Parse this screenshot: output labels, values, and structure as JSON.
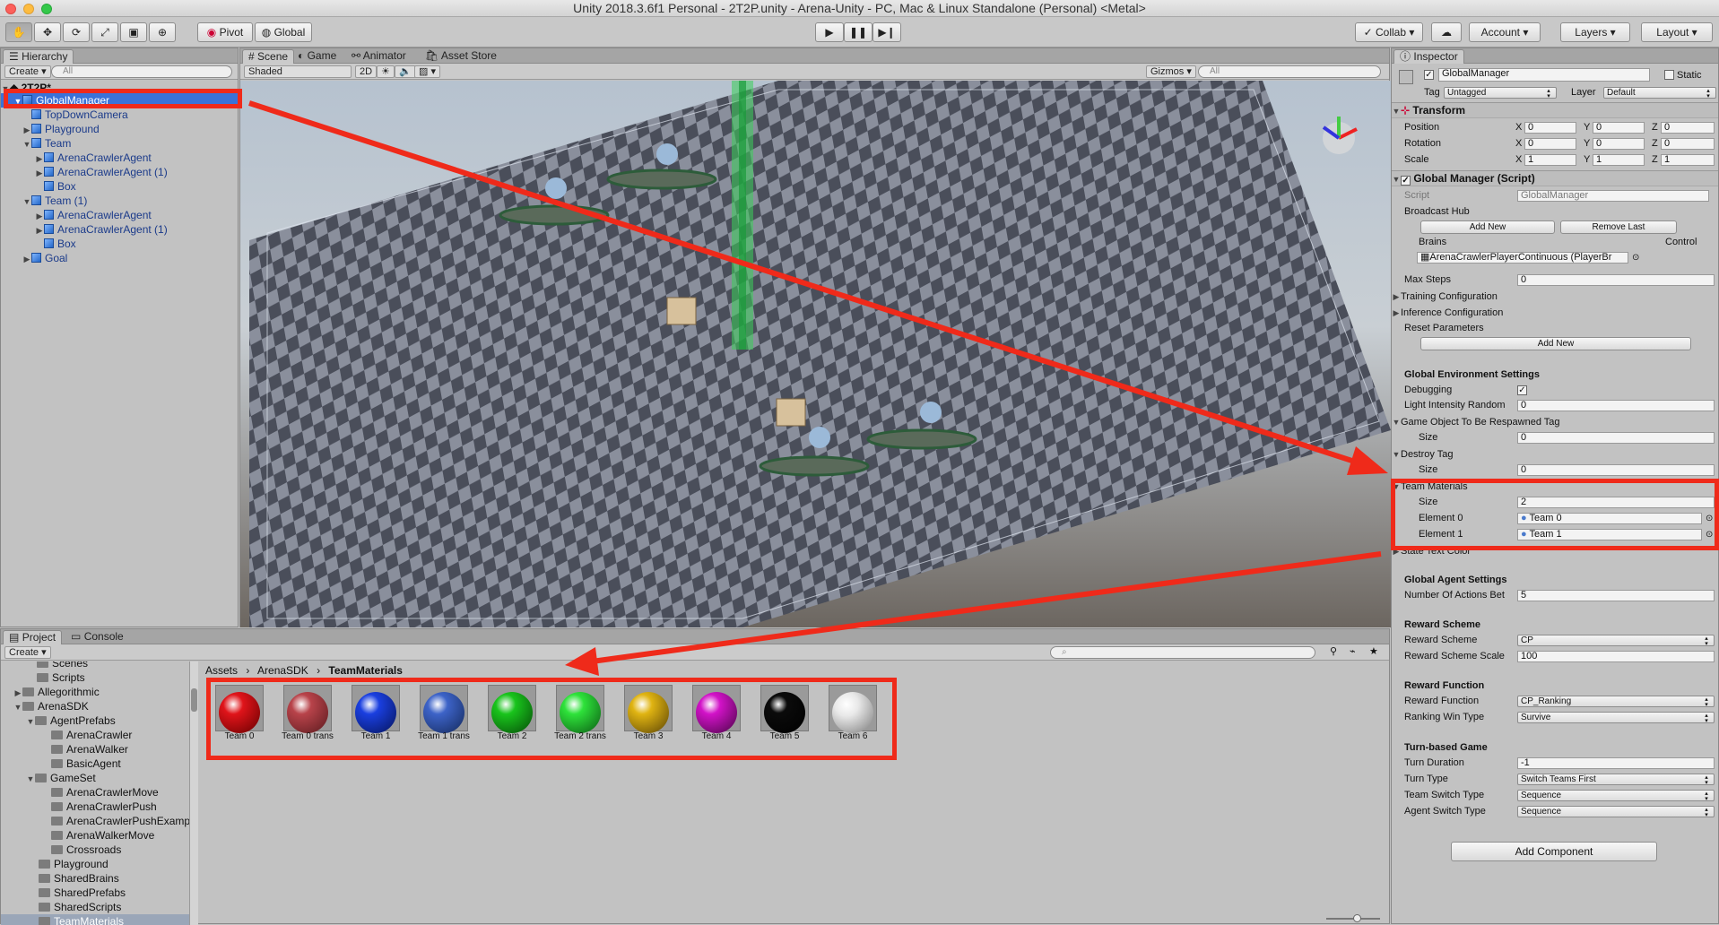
{
  "window_title": "Unity 2018.3.6f1 Personal - 2T2P.unity - Arena-Unity - PC, Mac & Linux Standalone (Personal) <Metal>",
  "toolbar": {
    "pivot": "Pivot",
    "global": "Global",
    "collab": "Collab",
    "account": "Account",
    "layers": "Layers",
    "layout": "Layout"
  },
  "hierarchy": {
    "tab": "Hierarchy",
    "create": "Create",
    "search_placeholder": "All",
    "scene_name": "2T2P*",
    "items": [
      {
        "label": "GlobalManager"
      },
      {
        "label": "TopDownCamera"
      },
      {
        "label": "Playground"
      },
      {
        "label": "Team"
      },
      {
        "label": "ArenaCrawlerAgent"
      },
      {
        "label": "ArenaCrawlerAgent (1)"
      },
      {
        "label": "Box"
      },
      {
        "label": "Team (1)"
      },
      {
        "label": "ArenaCrawlerAgent"
      },
      {
        "label": "ArenaCrawlerAgent (1)"
      },
      {
        "label": "Box"
      },
      {
        "label": "Goal"
      }
    ]
  },
  "scene": {
    "tabs": [
      "Scene",
      "Game",
      "Animator",
      "Asset Store"
    ],
    "shading": "Shaded",
    "mode_2d": "2D",
    "gizmos": "Gizmos",
    "search_placeholder": "All"
  },
  "project": {
    "tabs": [
      "Project",
      "Console"
    ],
    "create": "Create",
    "tree": [
      {
        "label": "Scenes"
      },
      {
        "label": "Scripts"
      },
      {
        "label": "Allegorithmic"
      },
      {
        "label": "ArenaSDK"
      },
      {
        "label": "AgentPrefabs"
      },
      {
        "label": "ArenaCrawler"
      },
      {
        "label": "ArenaWalker"
      },
      {
        "label": "BasicAgent"
      },
      {
        "label": "GameSet"
      },
      {
        "label": "ArenaCrawlerMove"
      },
      {
        "label": "ArenaCrawlerPush"
      },
      {
        "label": "ArenaCrawlerPushExamp"
      },
      {
        "label": "ArenaWalkerMove"
      },
      {
        "label": "Crossroads"
      },
      {
        "label": "Playground"
      },
      {
        "label": "SharedBrains"
      },
      {
        "label": "SharedPrefabs"
      },
      {
        "label": "SharedScripts"
      },
      {
        "label": "TeamMaterials"
      }
    ],
    "breadcrumb": [
      "Assets",
      "ArenaSDK",
      "TeamMaterials"
    ],
    "assets": [
      {
        "label": "Team 0",
        "color": "#e0141a"
      },
      {
        "label": "Team 0 trans",
        "color": "#b8434a"
      },
      {
        "label": "Team 1",
        "color": "#1a3fe0"
      },
      {
        "label": "Team 1 trans",
        "color": "#3d63c8"
      },
      {
        "label": "Team 2",
        "color": "#19c41c"
      },
      {
        "label": "Team 2 trans",
        "color": "#2ee23a"
      },
      {
        "label": "Team 3",
        "color": "#e0b412"
      },
      {
        "label": "Team 4",
        "color": "#d212c8"
      },
      {
        "label": "Team 5",
        "color": "#0b0b0b"
      },
      {
        "label": "Team 6",
        "color": "#e8e8e8"
      }
    ]
  },
  "inspector": {
    "tab": "Inspector",
    "object_name": "GlobalManager",
    "static_label": "Static",
    "tag_label": "Tag",
    "tag_value": "Untagged",
    "layer_label": "Layer",
    "layer_value": "Default",
    "transform": {
      "title": "Transform",
      "position_label": "Position",
      "rotation_label": "Rotation",
      "scale_label": "Scale",
      "position": [
        "0",
        "0",
        "0"
      ],
      "rotation": [
        "0",
        "0",
        "0"
      ],
      "scale": [
        "1",
        "1",
        "1"
      ],
      "x": "X",
      "y": "Y",
      "z": "Z"
    },
    "script_title": "Global Manager (Script)",
    "script_label": "Script",
    "script_value": "GlobalManager",
    "broadcast_hub": "Broadcast Hub",
    "add_new": "Add New",
    "remove_last": "Remove Last",
    "brains_label": "Brains",
    "control_label": "Control",
    "brain_value": "ArenaCrawlerPlayerContinuous (PlayerBr",
    "max_steps_label": "Max Steps",
    "max_steps": "0",
    "training_config": "Training Configuration",
    "inference_config": "Inference Configuration",
    "reset_parameters": "Reset Parameters",
    "reset_add_new": "Add New",
    "global_env_settings": "Global Environment Settings",
    "debugging_label": "Debugging",
    "light_label": "Light Intensity Random",
    "light_value": "0",
    "respawn_tag_label": "Game Object To Be Respawned Tag",
    "size_label": "Size",
    "respawn_size": "0",
    "destroy_tag_label": "Destroy Tag",
    "destroy_size": "0",
    "team_materials_label": "Team Materials",
    "team_materials_size": "2",
    "element0_label": "Element 0",
    "element0_value": "Team 0",
    "element1_label": "Element 1",
    "element1_value": "Team 1",
    "state_text_color": "State Text Color",
    "global_agent_settings": "Global Agent Settings",
    "num_actions_label": "Number Of Actions Bet",
    "num_actions": "5",
    "reward_scheme_header": "Reward Scheme",
    "reward_scheme_label": "Reward Scheme",
    "reward_scheme_value": "CP",
    "reward_scheme_scale_label": "Reward Scheme Scale",
    "reward_scheme_scale": "100",
    "reward_function_header": "Reward Function",
    "reward_function_label": "Reward Function",
    "reward_function_value": "CP_Ranking",
    "ranking_win_type_label": "Ranking Win Type",
    "ranking_win_type_value": "Survive",
    "turn_based_header": "Turn-based Game",
    "turn_duration_label": "Turn Duration",
    "turn_duration": "-1",
    "turn_type_label": "Turn Type",
    "turn_type_value": "Switch Teams First",
    "team_switch_type_label": "Team Switch Type",
    "team_switch_type_value": "Sequence",
    "agent_switch_type_label": "Agent Switch Type",
    "agent_switch_type_value": "Sequence",
    "add_component": "Add Component"
  },
  "colors": {
    "highlight": "#ef2a1a",
    "selection": "#3a72d8"
  }
}
